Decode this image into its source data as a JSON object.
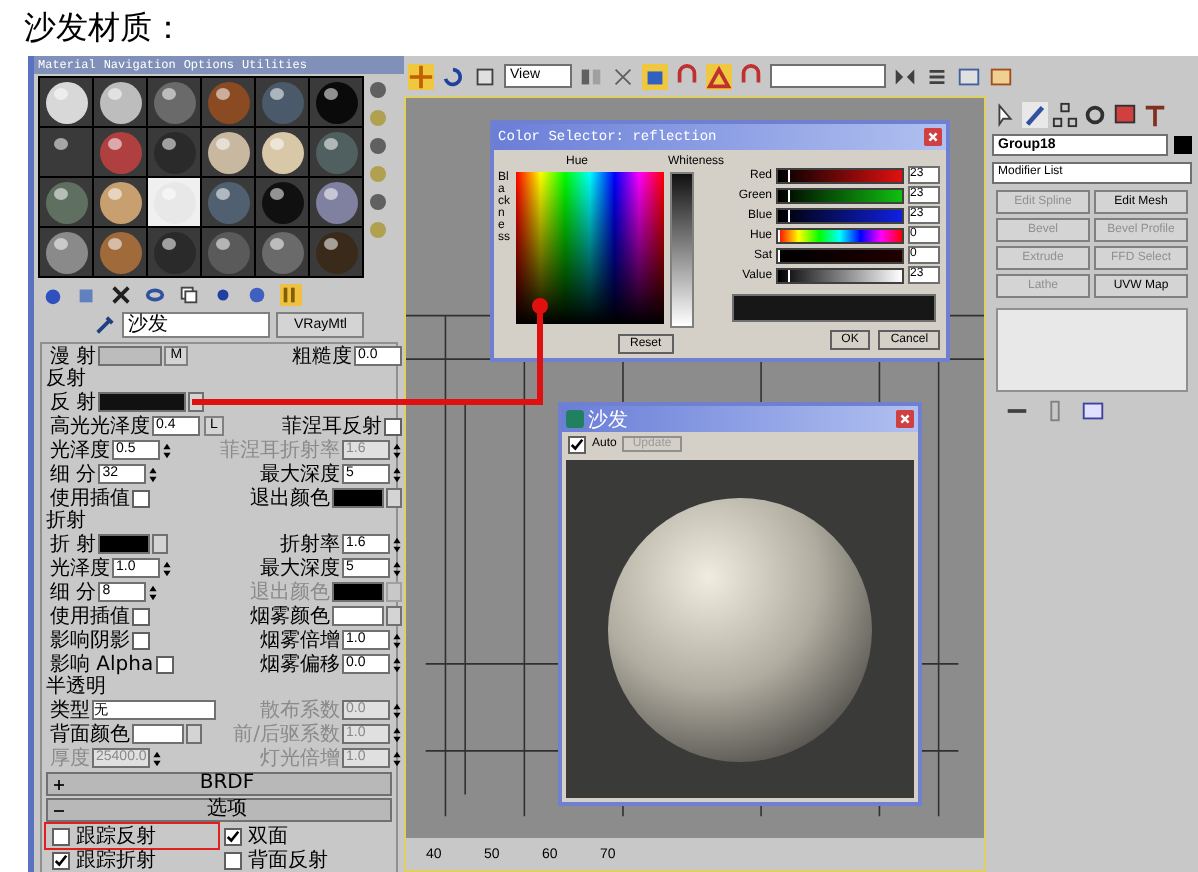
{
  "caption": "沙发材质：",
  "material_editor": {
    "menu": [
      "Material",
      "Navigation",
      "Options",
      "Utilities"
    ],
    "slots": [
      {
        "color": "#d8d8d8",
        "selected": false
      },
      {
        "color": "#bdbdbd",
        "selected": false
      },
      {
        "color": "#6a6a6a",
        "selected": false
      },
      {
        "color": "#8a4a22",
        "selected": false
      },
      {
        "color": "#4a5a6a",
        "selected": false
      },
      {
        "color": "#0a0a0a",
        "selected": false
      },
      {
        "color": "#3a3a3a",
        "selected": false
      },
      {
        "color": "#b04040",
        "selected": false
      },
      {
        "color": "#2a2a2a",
        "selected": false
      },
      {
        "color": "#c8b8a0",
        "selected": false
      },
      {
        "color": "#d8c8a8",
        "selected": false
      },
      {
        "color": "#506060",
        "selected": false
      },
      {
        "color": "#607060",
        "selected": false
      },
      {
        "color": "#c8a070",
        "selected": false
      },
      {
        "color": "#e8e8e8",
        "selected": true
      },
      {
        "color": "#506070",
        "selected": false
      },
      {
        "color": "#101010",
        "selected": false
      },
      {
        "color": "#8080a0",
        "selected": false
      },
      {
        "color": "#8a8a8a",
        "selected": false
      },
      {
        "color": "#a06a3a",
        "selected": false
      },
      {
        "color": "#2a2a2a",
        "selected": false
      },
      {
        "color": "#5a5a5a",
        "selected": false
      },
      {
        "color": "#6a6a6a",
        "selected": false
      },
      {
        "color": "#3a2a1a",
        "selected": false
      }
    ],
    "material_name": "沙发",
    "material_type": "VRayMtl",
    "diffuse": {
      "label": "漫 射",
      "map_button": "M",
      "roughness_label": "粗糙度",
      "roughness": "0.0"
    },
    "sections": [
      {
        "title": "反射",
        "rows": [
          {
            "cells": [
              {
                "kind": "swatch",
                "label": "反 射",
                "color": "#111111"
              }
            ]
          },
          {
            "cells": [
              {
                "kind": "spinner",
                "label": "高光光泽度",
                "value": "0.4",
                "lock_button": "L",
                "disabled": false
              },
              {
                "kind": "checkbox",
                "label": "菲涅耳反射",
                "checked": false
              }
            ]
          },
          {
            "cells": [
              {
                "kind": "spinner",
                "label": "光泽度",
                "value": "0.5",
                "disabled": false
              },
              {
                "kind": "spinner",
                "label": "菲涅耳折射率",
                "value": "1.6",
                "disabled": true
              }
            ]
          },
          {
            "cells": [
              {
                "kind": "spinner",
                "label": "细 分",
                "value": "32",
                "disabled": false
              },
              {
                "kind": "spinner",
                "label": "最大深度",
                "value": "5",
                "disabled": false
              }
            ]
          },
          {
            "cells": [
              {
                "kind": "checkbox",
                "label": "使用插值",
                "checked": false
              },
              {
                "kind": "swatch",
                "label": "退出颜色",
                "color": "#000000"
              }
            ]
          }
        ]
      },
      {
        "title": "折射",
        "rows": [
          {
            "cells": [
              {
                "kind": "swatch",
                "label": "折 射",
                "color": "#000000"
              },
              {
                "kind": "spinner",
                "label": "折射率",
                "value": "1.6",
                "disabled": false
              }
            ]
          },
          {
            "cells": [
              {
                "kind": "spinner",
                "label": "光泽度",
                "value": "1.0",
                "disabled": false
              },
              {
                "kind": "spinner",
                "label": "最大深度",
                "value": "5",
                "disabled": false
              }
            ]
          },
          {
            "cells": [
              {
                "kind": "spinner",
                "label": "细 分",
                "value": "8",
                "disabled": false
              },
              {
                "kind": "swatch",
                "label": "退出颜色",
                "color": "#000000",
                "disabled": true
              }
            ]
          },
          {
            "cells": [
              {
                "kind": "checkbox",
                "label": "使用插值",
                "checked": false
              },
              {
                "kind": "swatch",
                "label": "烟雾颜色",
                "color": "#ffffff"
              }
            ]
          },
          {
            "cells": [
              {
                "kind": "checkbox",
                "label": "影响阴影",
                "checked": false
              },
              {
                "kind": "spinner",
                "label": "烟雾倍增",
                "value": "1.0",
                "disabled": false
              }
            ]
          },
          {
            "cells": [
              {
                "kind": "checkbox",
                "label": "影响 Alpha",
                "checked": false
              },
              {
                "kind": "spinner",
                "label": "烟雾偏移",
                "value": "0.0",
                "disabled": false
              }
            ]
          }
        ]
      },
      {
        "title": "半透明",
        "rows": [
          {
            "cells": [
              {
                "kind": "dropdown",
                "label": "类型",
                "value": "无"
              },
              {
                "kind": "spinner",
                "label": "散布系数",
                "value": "0.0",
                "disabled": true
              }
            ]
          },
          {
            "cells": [
              {
                "kind": "swatch",
                "label": "背面颜色",
                "color": "#ffffff"
              },
              {
                "kind": "spinner",
                "label": "前/后驱系数",
                "value": "1.0",
                "disabled": true
              }
            ]
          },
          {
            "cells": [
              {
                "kind": "spinner",
                "label": "厚度",
                "value": "25400.0",
                "disabled": true
              },
              {
                "kind": "spinner",
                "label": "灯光倍增",
                "value": "1.0",
                "disabled": true
              }
            ]
          }
        ]
      }
    ],
    "rollouts": [
      {
        "title": "BRDF",
        "expanded": false
      },
      {
        "title": "选项",
        "expanded": true
      }
    ],
    "options": [
      {
        "label": "跟踪反射",
        "checked": false,
        "highlighted": true
      },
      {
        "label": "双面",
        "checked": true,
        "highlighted": false
      },
      {
        "label": "跟踪折射",
        "checked": true,
        "highlighted": false
      },
      {
        "label": "背面反射",
        "checked": false,
        "highlighted": false
      }
    ]
  },
  "toolbar": {
    "view_dropdown": "View"
  },
  "color_selector": {
    "title": "Color Selector: reflection",
    "hue_label": "Hue",
    "whiteness_label": "Whiteness",
    "blackness_label": "Blackness",
    "channels": [
      {
        "kind": "red",
        "label": "Red",
        "value": "23",
        "level": 0.09
      },
      {
        "kind": "green",
        "label": "Green",
        "value": "23",
        "level": 0.09
      },
      {
        "kind": "blue",
        "label": "Blue",
        "value": "23",
        "level": 0.09
      },
      {
        "kind": "hue",
        "label": "Hue",
        "value": "0",
        "level": 0
      },
      {
        "kind": "sat",
        "label": "Sat",
        "value": "0",
        "level": 0
      },
      {
        "kind": "value",
        "label": "Value",
        "value": "23",
        "level": 0.09
      }
    ],
    "color": "#171717",
    "buttons": [
      "Reset",
      "OK",
      "Cancel"
    ]
  },
  "render_window": {
    "title": "沙发",
    "auto_label": "Auto",
    "auto_checked": true,
    "update_button": "Update"
  },
  "timeline": [
    "40",
    "50",
    "60",
    "70"
  ],
  "command_panel": {
    "object_name": "Group18",
    "modifier_list": "Modifier List",
    "buttons": [
      {
        "label": "Edit Spline",
        "disabled": true
      },
      {
        "label": "Edit Mesh",
        "disabled": false
      },
      {
        "label": "Bevel",
        "disabled": true
      },
      {
        "label": "Bevel Profile",
        "disabled": true
      },
      {
        "label": "Extrude",
        "disabled": true
      },
      {
        "label": "FFD Select",
        "disabled": true
      },
      {
        "label": "Lathe",
        "disabled": true
      },
      {
        "label": "UVW Map",
        "disabled": false
      }
    ]
  }
}
